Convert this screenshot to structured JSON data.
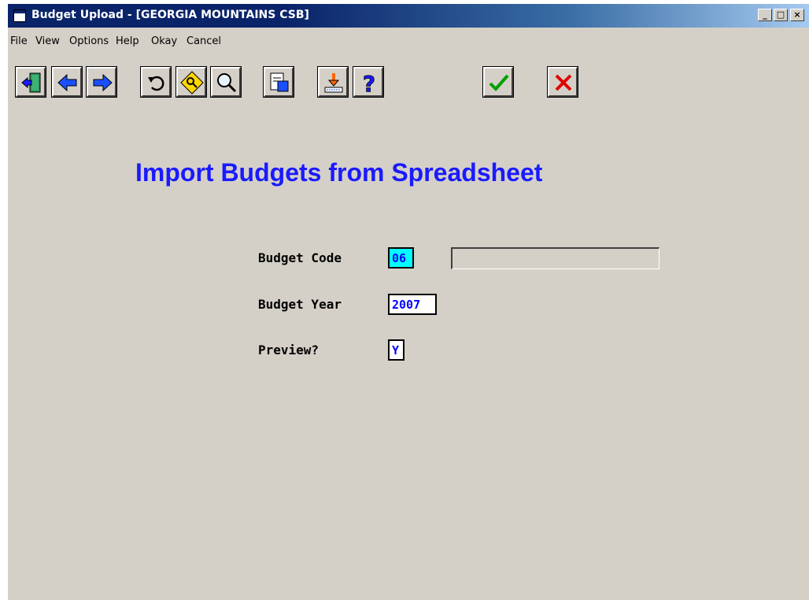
{
  "window": {
    "title": "Budget Upload - [GEORGIA MOUNTAINS CSB]",
    "minimize_glyph": "_",
    "maximize_glyph": "□",
    "close_glyph": "×"
  },
  "menu": {
    "items": [
      {
        "label": "File"
      },
      {
        "label": "View"
      },
      {
        "label": "Options"
      },
      {
        "label": "Help"
      },
      {
        "label": "Okay"
      },
      {
        "label": "Cancel"
      }
    ]
  },
  "toolbar": {
    "buttons": [
      {
        "icon": "exit-icon"
      },
      {
        "icon": "back-arrow-icon"
      },
      {
        "icon": "forward-arrow-icon"
      },
      {
        "icon": "undo-icon"
      },
      {
        "icon": "key-diamond-icon"
      },
      {
        "icon": "magnifier-icon"
      },
      {
        "icon": "clipboard-icon"
      },
      {
        "icon": "download-icon"
      },
      {
        "icon": "help-icon"
      },
      {
        "icon": "okay-check-icon"
      },
      {
        "icon": "cancel-x-icon"
      }
    ]
  },
  "form": {
    "heading": "Import Budgets from Spreadsheet",
    "budget_code_label": "Budget Code",
    "budget_code_value": "06",
    "budget_code_description": "",
    "budget_year_label": "Budget Year",
    "budget_year_value": "2007",
    "preview_label": "Preview?",
    "preview_value": "Y"
  },
  "colors": {
    "heading": "#1a1aff",
    "field_text": "#0000ff",
    "focused_field": "#00ffff",
    "window_bg": "#d4d0c8"
  }
}
